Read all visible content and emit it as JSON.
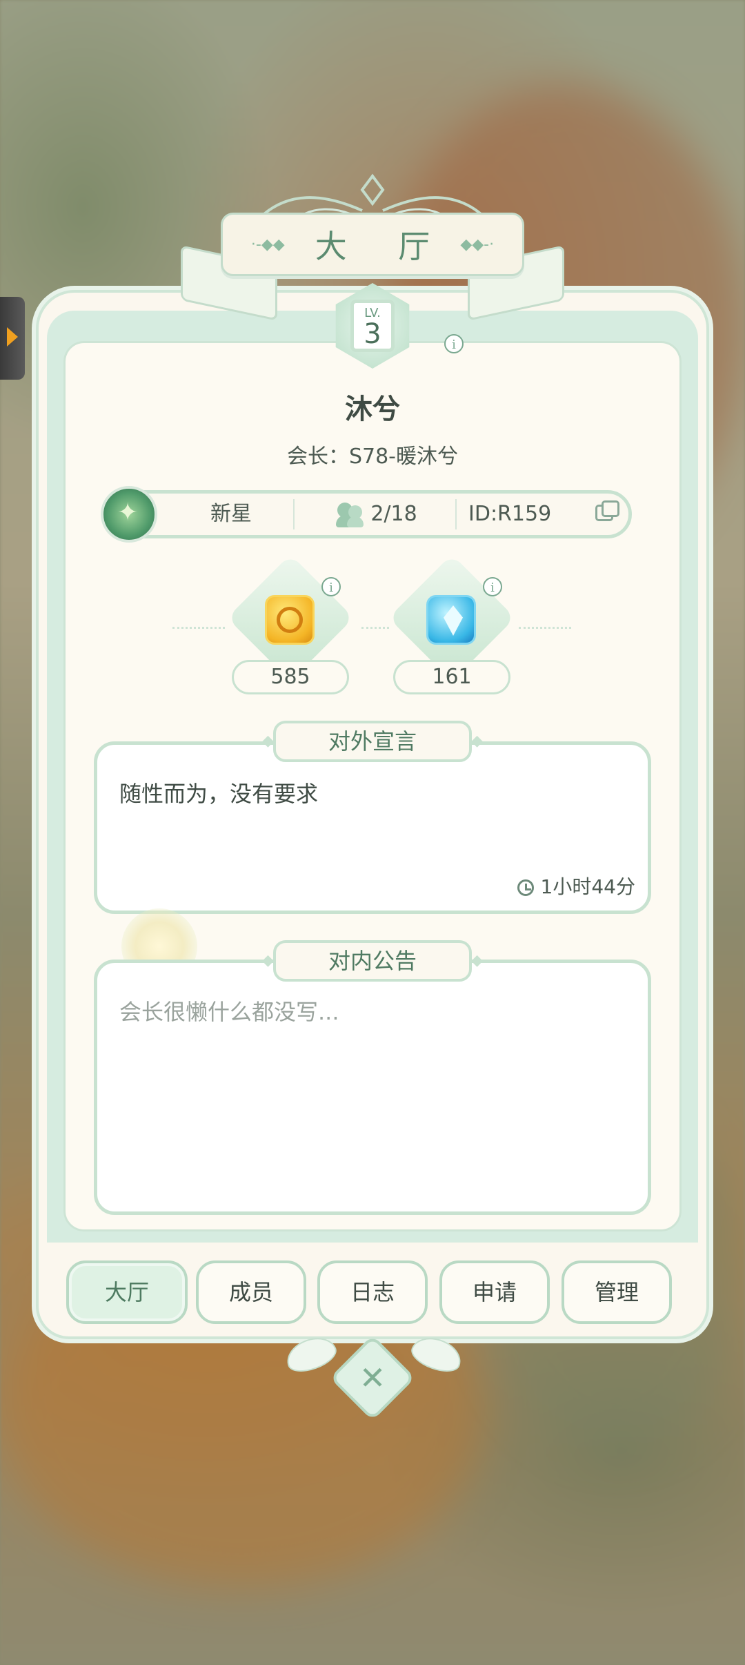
{
  "header": {
    "title": "大 厅"
  },
  "guild": {
    "level_label": "LV.",
    "level": "3",
    "name": "沐兮",
    "leader": "会长：S78-暖沐兮",
    "rank": "新星",
    "members": "2/18",
    "id": "ID:R159"
  },
  "resources": [
    {
      "icon": "gold-key-icon",
      "value": "585"
    },
    {
      "icon": "blue-gem-icon",
      "value": "161"
    }
  ],
  "declaration": {
    "title": "对外宣言",
    "text": "随性而为，没有要求",
    "time": "1小时44分"
  },
  "notice": {
    "title": "对内公告",
    "placeholder": "会长很懒什么都没写..."
  },
  "tabs": [
    {
      "label": "大厅",
      "active": true
    },
    {
      "label": "成员",
      "active": false
    },
    {
      "label": "日志",
      "active": false
    },
    {
      "label": "申请",
      "active": false
    },
    {
      "label": "管理",
      "active": false
    }
  ],
  "colors": {
    "accent_green": "#5b8b70",
    "border_green": "#c8e2d0",
    "panel_bg": "#fbf7ee"
  }
}
